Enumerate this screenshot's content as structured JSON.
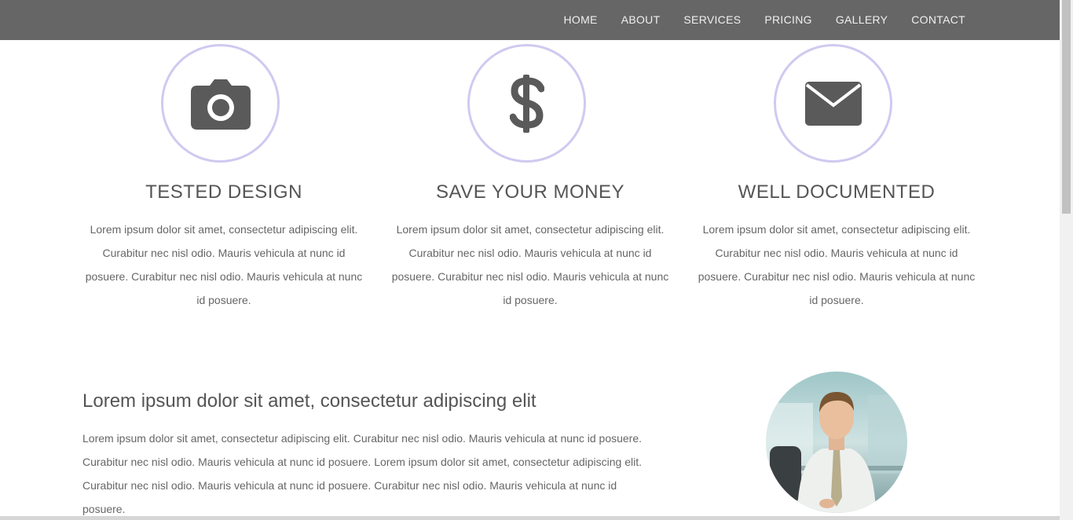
{
  "nav": {
    "items": [
      "HOME",
      "ABOUT",
      "SERVICES",
      "PRICING",
      "GALLERY",
      "CONTACT"
    ]
  },
  "features": [
    {
      "icon": "camera-icon",
      "title": "TESTED DESIGN",
      "text": "Lorem ipsum dolor sit amet, consectetur adipiscing elit. Curabitur nec nisl odio. Mauris vehicula at nunc id posuere. Curabitur nec nisl odio. Mauris vehicula at nunc id posuere."
    },
    {
      "icon": "dollar-icon",
      "title": "SAVE YOUR MONEY",
      "text": "Lorem ipsum dolor sit amet, consectetur adipiscing elit. Curabitur nec nisl odio. Mauris vehicula at nunc id posuere. Curabitur nec nisl odio. Mauris vehicula at nunc id posuere."
    },
    {
      "icon": "envelope-icon",
      "title": "WELL DOCUMENTED",
      "text": "Lorem ipsum dolor sit amet, consectetur adipiscing elit. Curabitur nec nisl odio. Mauris vehicula at nunc id posuere. Curabitur nec nisl odio. Mauris vehicula at nunc id posuere."
    }
  ],
  "about": {
    "heading": "Lorem ipsum dolor sit amet, consectetur adipiscing elit",
    "text": "Lorem ipsum dolor sit amet, consectetur adipiscing elit. Curabitur nec nisl odio. Mauris vehicula at nunc id posuere. Curabitur nec nisl odio. Mauris vehicula at nunc id posuere. Lorem ipsum dolor sit amet, consectetur adipiscing elit. Curabitur nec nisl odio. Mauris vehicula at nunc id posuere. Curabitur nec nisl odio. Mauris vehicula at nunc id posuere."
  },
  "colors": {
    "navbar": "#666666",
    "icon_ring": "#cfcaf0",
    "icon_fill": "#5a5a5a"
  }
}
